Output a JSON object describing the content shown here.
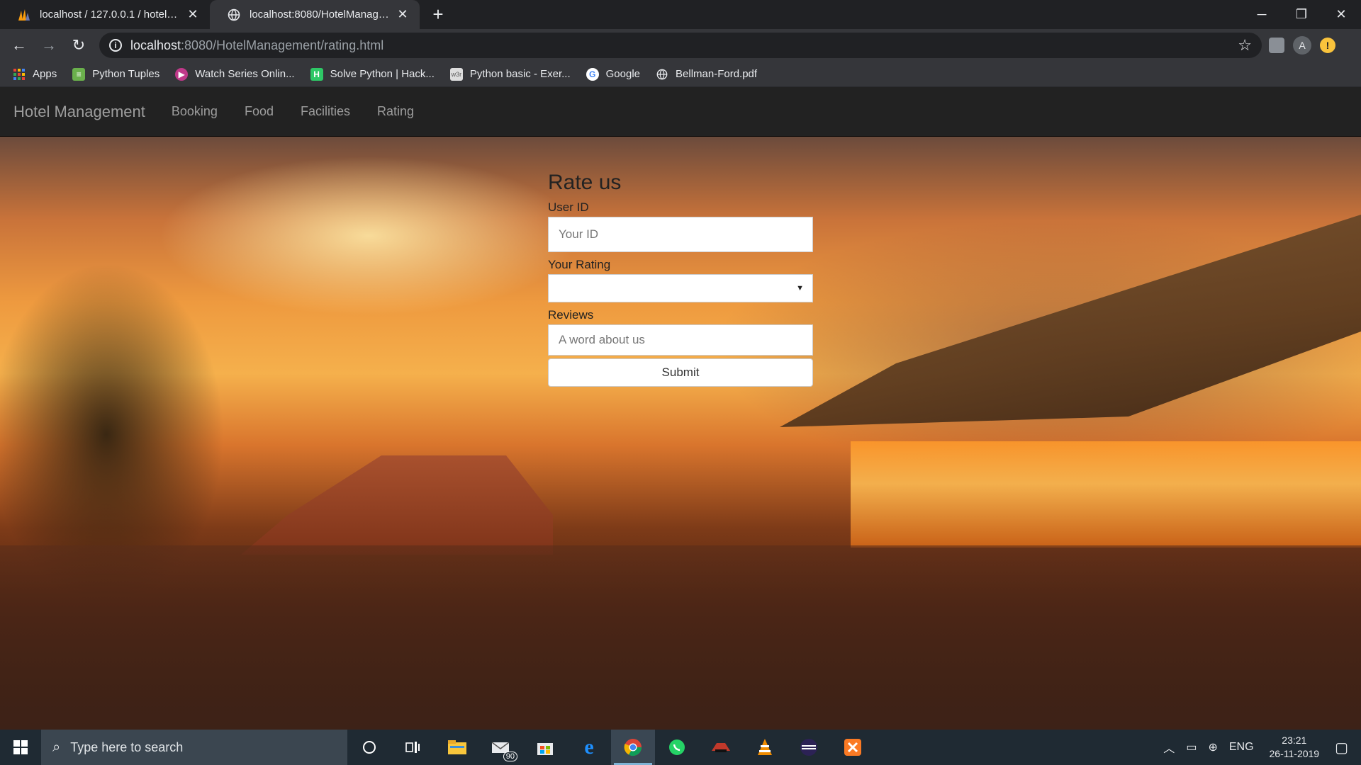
{
  "browser": {
    "tabs": [
      {
        "title": "localhost / 127.0.0.1 / hotelmana",
        "icon": "phpmyadmin-icon",
        "active": false
      },
      {
        "title": "localhost:8080/HotelManagemen",
        "icon": "globe-icon",
        "active": true
      }
    ],
    "new_tab": "+",
    "window_controls": {
      "minimize": "─",
      "restore": "❐",
      "close": "✕"
    },
    "url": {
      "host": "localhost",
      "path": ":8080/HotelManagement/rating.html"
    },
    "profile_initial": "A",
    "update_badge": "!"
  },
  "bookmarks": [
    {
      "label": "Apps",
      "icon": "apps-grid-icon",
      "color": "#4285f4"
    },
    {
      "label": "Python Tuples",
      "icon": "python-tuples-icon",
      "color": "#6ab04c"
    },
    {
      "label": "Watch Series Onlin...",
      "icon": "play-icon",
      "color": "#c0398a"
    },
    {
      "label": "Solve Python | Hack...",
      "icon": "hackerrank-icon",
      "color": "#2ec866"
    },
    {
      "label": "Python basic - Exer...",
      "icon": "w3r-icon",
      "color": "#dddddd"
    },
    {
      "label": "Google",
      "icon": "google-icon",
      "color": "#ffffff"
    },
    {
      "label": "Bellman-Ford.pdf",
      "icon": "globe-icon",
      "color": "#e8eaed"
    }
  ],
  "site": {
    "brand": "Hotel Management",
    "nav": [
      "Booking",
      "Food",
      "Facilities",
      "Rating"
    ]
  },
  "form": {
    "title": "Rate us",
    "user_id_label": "User ID",
    "user_id_placeholder": "Your ID",
    "rating_label": "Your Rating",
    "rating_value": "",
    "reviews_label": "Reviews",
    "reviews_placeholder": "A word about us",
    "submit_label": "Submit"
  },
  "taskbar": {
    "search_placeholder": "Type here to search",
    "mail_badge": "90",
    "language": "ENG",
    "time": "23:21",
    "date": "26-11-2019"
  },
  "colors": {
    "chrome_dark": "#202124",
    "chrome_toolbar": "#35363a",
    "navbar": "#222222",
    "taskbar": "#1f2a33"
  }
}
